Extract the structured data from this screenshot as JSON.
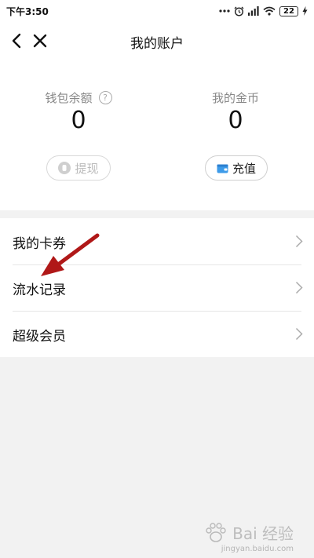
{
  "status_bar": {
    "time": "下午3:50",
    "battery": "22"
  },
  "nav": {
    "title": "我的账户"
  },
  "account": {
    "wallet_label": "钱包余额",
    "wallet_value": "0",
    "coins_label": "我的金币",
    "coins_value": "0",
    "withdraw_label": "提现",
    "recharge_label": "充值"
  },
  "menu": {
    "items": [
      {
        "label": "我的卡券"
      },
      {
        "label": "流水记录"
      },
      {
        "label": "超级会员"
      }
    ]
  },
  "annotation": {
    "arrow_color": "#b01818"
  },
  "watermark": {
    "text": "Bai 经验",
    "sub": "jingyan.baidu.com"
  }
}
